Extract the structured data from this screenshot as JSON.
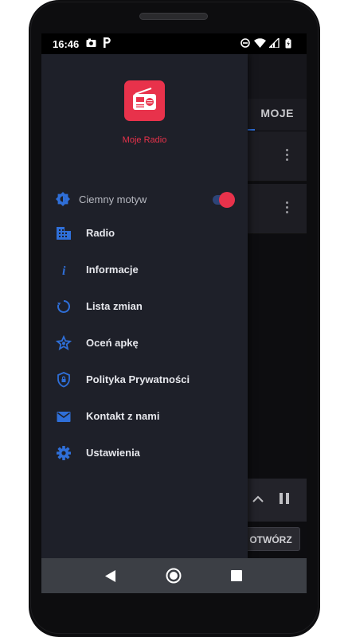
{
  "status_bar": {
    "time": "16:46",
    "icons": [
      "photo-icon",
      "parking-icon",
      "dnd-icon",
      "wifi-icon",
      "signal-icon",
      "battery-icon"
    ]
  },
  "app": {
    "tab_label": "MOJE",
    "open_button_label": "OTWÓRZ"
  },
  "drawer": {
    "app_title": "Moje Radio",
    "theme_toggle": {
      "label": "Ciemny motyw",
      "enabled": true
    },
    "items": [
      {
        "label": "Radio",
        "icon": "grid-icon"
      },
      {
        "label": "Informacje",
        "icon": "info-icon"
      },
      {
        "label": "Lista zmian",
        "icon": "history-icon"
      },
      {
        "label": "Oceń apkę",
        "icon": "star-icon"
      },
      {
        "label": "Polityka Prywatności",
        "icon": "shield-icon"
      },
      {
        "label": "Kontakt z nami",
        "icon": "mail-icon"
      },
      {
        "label": "Ustawienia",
        "icon": "gear-icon"
      }
    ]
  },
  "colors": {
    "accent_red": "#e8324b",
    "accent_blue": "#2f6fd8",
    "drawer_bg": "#1e2029"
  }
}
